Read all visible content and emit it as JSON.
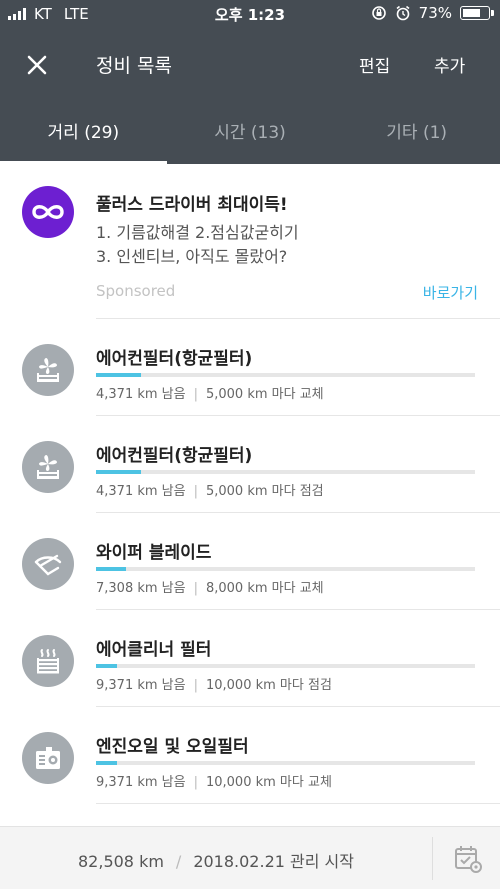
{
  "status_bar": {
    "carrier": "KT",
    "network": "LTE",
    "time": "오후 1:23",
    "battery_percent": "73%",
    "battery_level": 0.73
  },
  "toolbar": {
    "title": "정비 목록",
    "edit_label": "편집",
    "add_label": "추가"
  },
  "tabs": [
    {
      "label": "거리 (29)",
      "active": true
    },
    {
      "label": "시간 (13)",
      "active": false
    },
    {
      "label": "기타 (1)",
      "active": false
    }
  ],
  "ad": {
    "title": "풀러스 드라이버 최대이득!",
    "line1": "1. 기름값해결 2.점심값굳히기",
    "line2": "3. 인센티브, 아직도 몰랐어?",
    "sponsored": "Sponsored",
    "link_label": "바로가기",
    "logo_color": "#6d1fd1"
  },
  "items": [
    {
      "name": "에어컨필터(항균필터)",
      "remaining": "4,371 km 남음",
      "interval": "5,000 km 마다 교체",
      "progress": 0.12,
      "icon": "fan-filter-icon"
    },
    {
      "name": "에어컨필터(항균필터)",
      "remaining": "4,371 km 남음",
      "interval": "5,000 km 마다 점검",
      "progress": 0.12,
      "icon": "fan-filter-icon"
    },
    {
      "name": "와이퍼 블레이드",
      "remaining": "7,308 km 남음",
      "interval": "8,000 km 마다 교체",
      "progress": 0.08,
      "icon": "wiper-icon"
    },
    {
      "name": "에어클리너 필터",
      "remaining": "9,371 km 남음",
      "interval": "10,000 km 마다 점검",
      "progress": 0.055,
      "icon": "air-cleaner-icon"
    },
    {
      "name": "엔진오일 및 오일필터",
      "remaining": "9,371 km 남음",
      "interval": "10,000 km 마다 교체",
      "progress": 0.055,
      "icon": "engine-oil-icon"
    }
  ],
  "footer": {
    "mileage": "82,508 km",
    "start_date": "2018.02.21 관리 시작"
  },
  "colors": {
    "header": "#454c53",
    "accent": "#4dc3e3",
    "link": "#3ab4e6",
    "icon_bg": "#a5abb0"
  }
}
